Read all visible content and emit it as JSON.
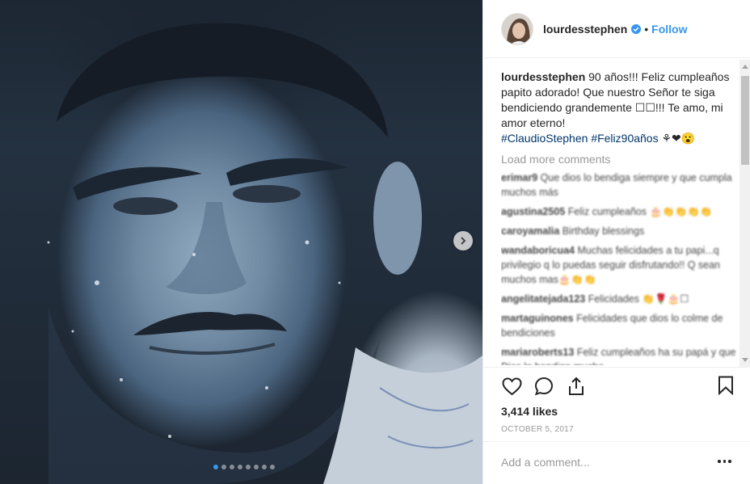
{
  "post": {
    "username": "lourdesstephen",
    "follow_label": "Follow",
    "separator": "•",
    "caption_text": "90 años!!! Feliz cumpleaños papito adorado! Que nuestro Señor te siga bendiciendo grandemente ☐☐!!! Te amo, mi amor eterno!",
    "hashtags": [
      "#ClaudioStephen",
      "#Feliz90años"
    ],
    "caption_emoji": "⚘❤😮",
    "load_more_label": "Load more comments",
    "likes": "3,414 likes",
    "date": "October 5, 2017",
    "comment_placeholder": "Add a comment...",
    "carousel": {
      "slides": 8,
      "active_index": 0
    }
  },
  "comments": [
    {
      "user": "erimar9",
      "text": "Que dios lo bendiga siempre y que cumpla muchos más"
    },
    {
      "user": "agustina2505",
      "text": "Feliz cumpleaños 🎂👏👏👏👏"
    },
    {
      "user": "caroyamalia",
      "text": "Birthday blessings"
    },
    {
      "user": "wandaboricua4",
      "text": "Muchas felicidades a tu papi...q privilegio q lo puedas seguir disfrutando!! Q sean muchos mas🎂👏👏"
    },
    {
      "user": "angelitatejada123",
      "text": "Felicidades 👏🌹🎂☐"
    },
    {
      "user": "martaguinones",
      "text": "Felicidades que dios lo colme de bendiciones"
    },
    {
      "user": "mariaroberts13",
      "text": "Feliz cumpleaños ha su papá y que Dios lo bendiga mucho"
    }
  ],
  "colors": {
    "accent": "#3897f0",
    "hashtag": "#003569",
    "text": "#262626",
    "muted": "#999999",
    "border": "#efefef"
  },
  "icons": {
    "heart": "heart-icon",
    "comment": "comment-icon",
    "share": "share-icon",
    "save": "bookmark-icon",
    "next": "chevron-right-icon",
    "verified": "verified-badge-icon",
    "more": "more-options-icon"
  }
}
